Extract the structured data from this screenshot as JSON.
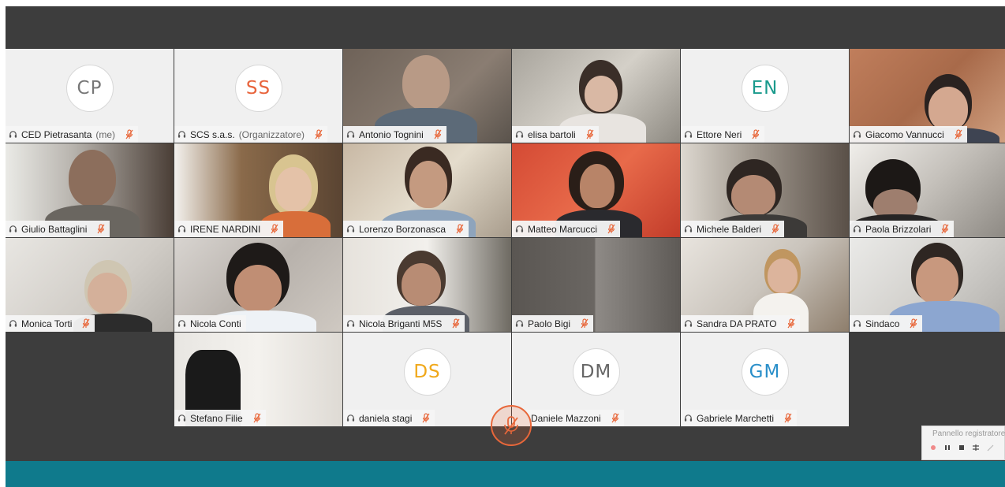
{
  "participants": [
    {
      "name": "CED Pietrasanta",
      "suffix": "(me)",
      "initials": "CP",
      "initials_color": "#777777"
    },
    {
      "name": "SCS s.a.s.",
      "suffix": "(Organizzatore)",
      "initials": "SS",
      "initials_color": "#e8643c"
    },
    {
      "name": "Antonio Tognini"
    },
    {
      "name": "elisa bartoli"
    },
    {
      "name": "Ettore Neri",
      "initials": "EN",
      "initials_color": "#1a9a8c"
    },
    {
      "name": "Giacomo Vannucci"
    },
    {
      "name": "Giulio Battaglini"
    },
    {
      "name": "IRENE NARDINI"
    },
    {
      "name": "Lorenzo Borzonasca"
    },
    {
      "name": "Matteo Marcucci"
    },
    {
      "name": "Michele Balderi"
    },
    {
      "name": "Paola Brizzolari"
    },
    {
      "name": "Monica Torti"
    },
    {
      "name": "Nicola Conti"
    },
    {
      "name": "Nicola Briganti M5S"
    },
    {
      "name": "Paolo Bigi"
    },
    {
      "name": "Sandra DA PRATO"
    },
    {
      "name": "Sindaco"
    },
    {
      "name": "Stefano Filie"
    },
    {
      "name": "daniela stagi",
      "initials": "DS",
      "initials_color": "#f0a81a"
    },
    {
      "name": "Daniele Mazzoni",
      "initials": "DM",
      "initials_color": "#666666"
    },
    {
      "name": "Gabriele Marchetti",
      "initials": "GM",
      "initials_color": "#2a8fc9"
    }
  ],
  "active_speaker": "Nicola Conti",
  "recorder_panel": {
    "title": "Pannello registratore"
  },
  "colors": {
    "accent": "#0f7a8c",
    "muted": "#e8673a",
    "active_border": "#2ea3e6",
    "stage": "#3d3d3d"
  },
  "icons": {
    "headset": "headset-icon",
    "mic_off": "mic-off-icon",
    "record": "record-icon",
    "pause": "pause-icon",
    "stop": "stop-icon"
  }
}
